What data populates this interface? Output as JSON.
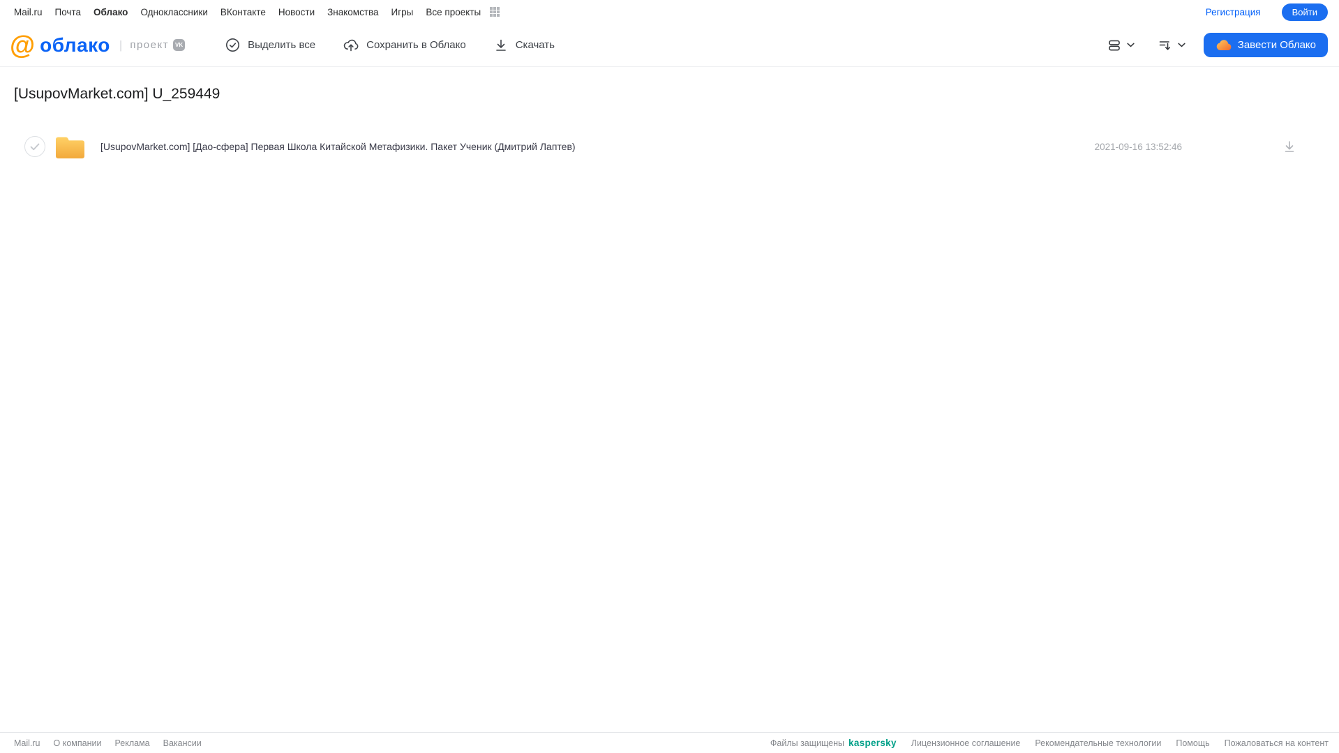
{
  "topnav": {
    "items": [
      "Mail.ru",
      "Почта",
      "Облако",
      "Одноклассники",
      "ВКонтакте",
      "Новости",
      "Знакомства",
      "Игры",
      "Все проекты"
    ],
    "registration": "Регистрация",
    "login": "Войти"
  },
  "logo": {
    "at": "@",
    "word": "облако",
    "divider": "|",
    "project": "проект",
    "vk": "VK"
  },
  "toolbar": {
    "select_all": "Выделить все",
    "save_to_cloud": "Сохранить в Облако",
    "download": "Скачать",
    "get_cloud": "Завести Облако"
  },
  "main": {
    "title": "[UsupovMarket.com] U_259449",
    "files": [
      {
        "type": "folder",
        "name": "[UsupovMarket.com] [Дао-сфера] Первая Школа Китайской Метафизики. Пакет Ученик (Дмитрий Лаптев)",
        "date": "2021-09-16 13:52:46"
      }
    ]
  },
  "footer": {
    "left_links": [
      "Mail.ru",
      "О компании",
      "Реклама",
      "Вакансии"
    ],
    "protected_label": "Файлы защищены",
    "kaspersky": "kaspersky",
    "right_links": [
      "Лицензионное соглашение",
      "Рекомендательные технологии",
      "Помощь",
      "Пожаловаться на контент"
    ]
  },
  "colors": {
    "brand_blue": "#1b6ef0",
    "logo_orange": "#ff9e00",
    "folder_yellow": "#f5b63e",
    "kaspersky_teal": "#00a088"
  }
}
